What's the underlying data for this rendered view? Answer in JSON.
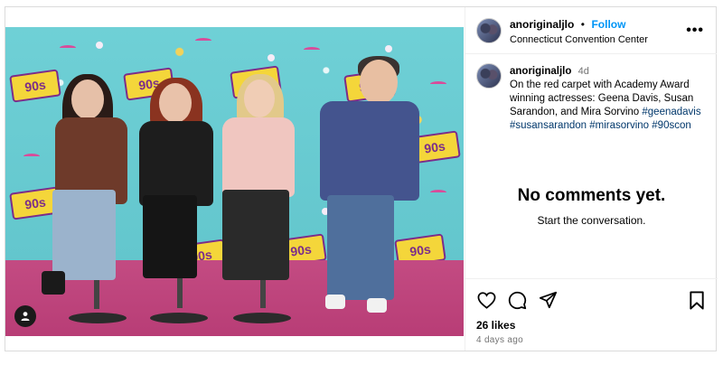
{
  "post": {
    "username": "anoriginaljlo",
    "follow_label": "Follow",
    "location": "Connecticut Convention Center",
    "more_label": "•••",
    "caption": {
      "username": "anoriginaljlo",
      "time": "4d",
      "text": "On the red carpet with Academy Award winning actresses: Geena Davis, Susan Sarandon, and Mira Sorvino ",
      "hashtags": [
        "#geenadavis",
        "#susansarandon",
        "#mirasorvino",
        "#90scon"
      ]
    },
    "comments": {
      "empty_title": "No comments yet.",
      "empty_subtitle": "Start the conversation."
    },
    "likes_text": "26 likes",
    "posted_ago": "4 days ago"
  },
  "photo": {
    "backdrop_logo_text": "90s",
    "carpet_color": "#b83d76",
    "backdrop_color": "#63c9cf"
  },
  "icons": {
    "like": "heart-icon",
    "comment": "comment-bubble-icon",
    "share": "paper-plane-icon",
    "save": "bookmark-icon",
    "user_tag": "user-tag-icon",
    "more": "more-options-icon"
  },
  "colors": {
    "link_blue": "#0095f6",
    "hashtag": "#00376b",
    "muted": "#737373",
    "border": "#dbdbdb"
  }
}
